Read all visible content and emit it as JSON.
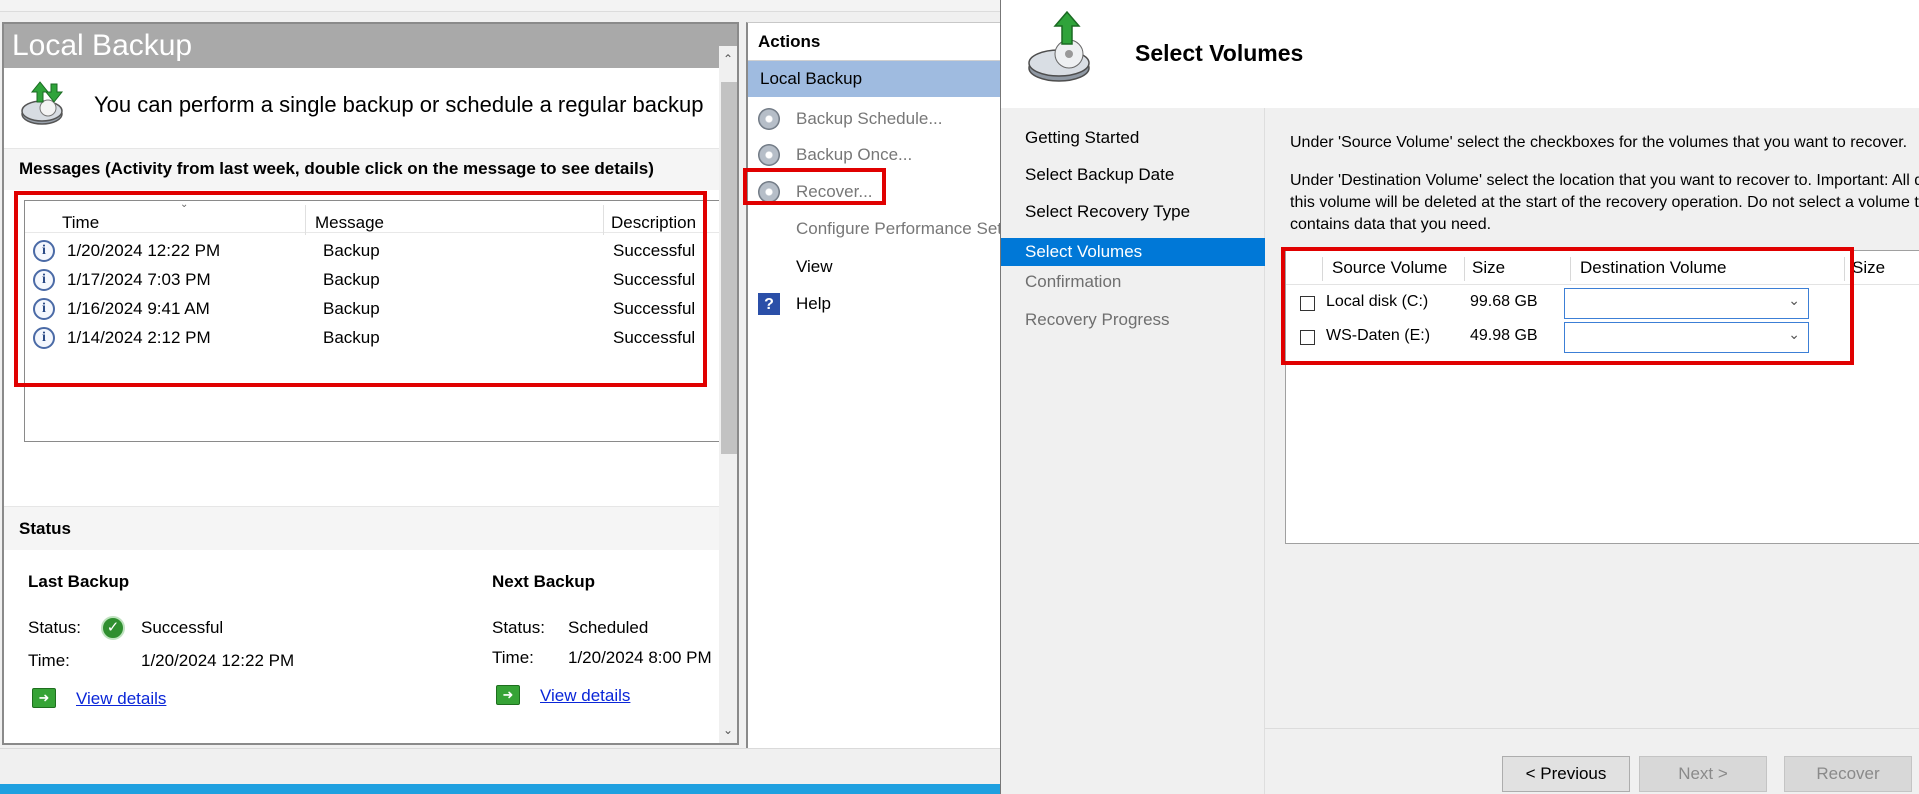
{
  "left": {
    "title": "Local Backup",
    "intro_text": "You can perform a single backup or schedule a regular backup",
    "messages_header": "Messages (Activity from last week, double click on the message to see details)",
    "columns": [
      "Time",
      "Message",
      "Description"
    ],
    "rows": [
      {
        "time": "1/20/2024 12:22 PM",
        "message": "Backup",
        "description": "Successful"
      },
      {
        "time": "1/17/2024 7:03 PM",
        "message": "Backup",
        "description": "Successful"
      },
      {
        "time": "1/16/2024 9:41 AM",
        "message": "Backup",
        "description": "Successful"
      },
      {
        "time": "1/14/2024 2:12 PM",
        "message": "Backup",
        "description": "Successful"
      }
    ],
    "status_header": "Status",
    "last_backup": {
      "title": "Last Backup",
      "status_label": "Status:",
      "status_value": "Successful",
      "time_label": "Time:",
      "time_value": "1/20/2024 12:22 PM",
      "link": "View details"
    },
    "next_backup": {
      "title": "Next Backup",
      "status_label": "Status:",
      "status_value": "Scheduled",
      "time_label": "Time:",
      "time_value": "1/20/2024 8:00 PM",
      "link": "View details"
    }
  },
  "actions": {
    "title": "Actions",
    "group": "Local Backup",
    "items": [
      {
        "label": "Backup Schedule...",
        "icon": "backup-schedule-icon"
      },
      {
        "label": "Backup Once...",
        "icon": "backup-once-icon"
      },
      {
        "label": "Recover...",
        "icon": "recover-icon"
      },
      {
        "label": "Configure Performance Settings...",
        "icon": "none"
      },
      {
        "label": "View",
        "icon": "none"
      },
      {
        "label": "Help",
        "icon": "help-icon"
      }
    ]
  },
  "wizard": {
    "title": "Select Volumes",
    "nav": [
      "Getting Started",
      "Select Backup Date",
      "Select Recovery Type",
      "Select Volumes",
      "Confirmation",
      "Recovery Progress"
    ],
    "selected_step": "Select Volumes",
    "instruction_1": "Under 'Source Volume' select the checkboxes for the volumes that you want to recover.",
    "instruction_2a": "Under 'Destination Volume' select the location that you want to recover to. Important: All data on",
    "instruction_2b": "this volume will be deleted at the start of the recovery operation. Do not select a volume that",
    "instruction_2c": "contains data that you need.",
    "columns": [
      "Source Volume",
      "Size",
      "Destination Volume",
      "Size"
    ],
    "volumes": [
      {
        "name": "Local disk (C:)",
        "size": "99.68 GB",
        "destination": ""
      },
      {
        "name": "WS-Daten (E:)",
        "size": "49.98 GB",
        "destination": ""
      }
    ],
    "buttons": {
      "previous": "< Previous",
      "next": "Next >",
      "recover": "Recover"
    }
  },
  "colors": {
    "highlight": "#e00000",
    "selection": "#0078d7",
    "actions_group": "#9fbbe0",
    "link": "#0a26d8"
  }
}
